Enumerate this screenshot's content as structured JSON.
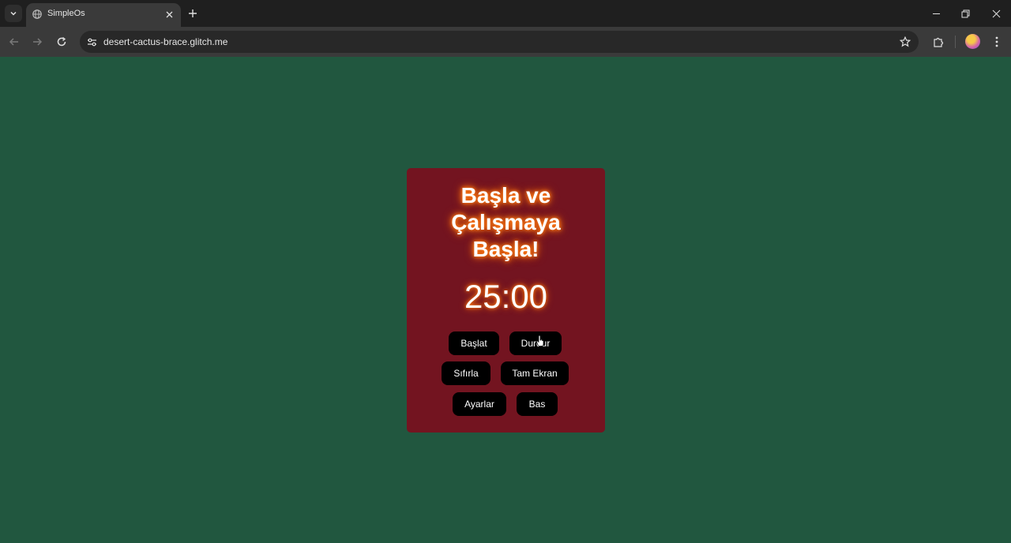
{
  "browser": {
    "tab_title": "SimpleOs",
    "url": "desert-cactus-brace.glitch.me",
    "icons": {
      "tab_search": "chevron-down-icon",
      "favicon": "globe-icon",
      "tab_close": "close-icon",
      "new_tab": "plus-icon",
      "minimize": "minimize-icon",
      "restore": "restore-icon",
      "close_window": "close-icon",
      "back": "arrow-left-icon",
      "forward": "arrow-right-icon",
      "reload": "reload-icon",
      "site_info": "tune-icon",
      "bookmark": "star-icon",
      "extensions": "puzzle-icon",
      "profile": "avatar",
      "menu": "kebab-menu-icon"
    }
  },
  "page": {
    "background_color": "#21573f",
    "card_color": "#731420",
    "glow_color": "#ff7a14",
    "heading_lines": [
      "Başla ve",
      "Çalışmaya",
      "Başla!"
    ],
    "timer": "25:00",
    "buttons": {
      "start": "Başlat",
      "stop": "Durdur",
      "reset": "Sıfırla",
      "fullscreen": "Tam Ekran",
      "settings": "Ayarlar",
      "press": "Bas"
    }
  }
}
